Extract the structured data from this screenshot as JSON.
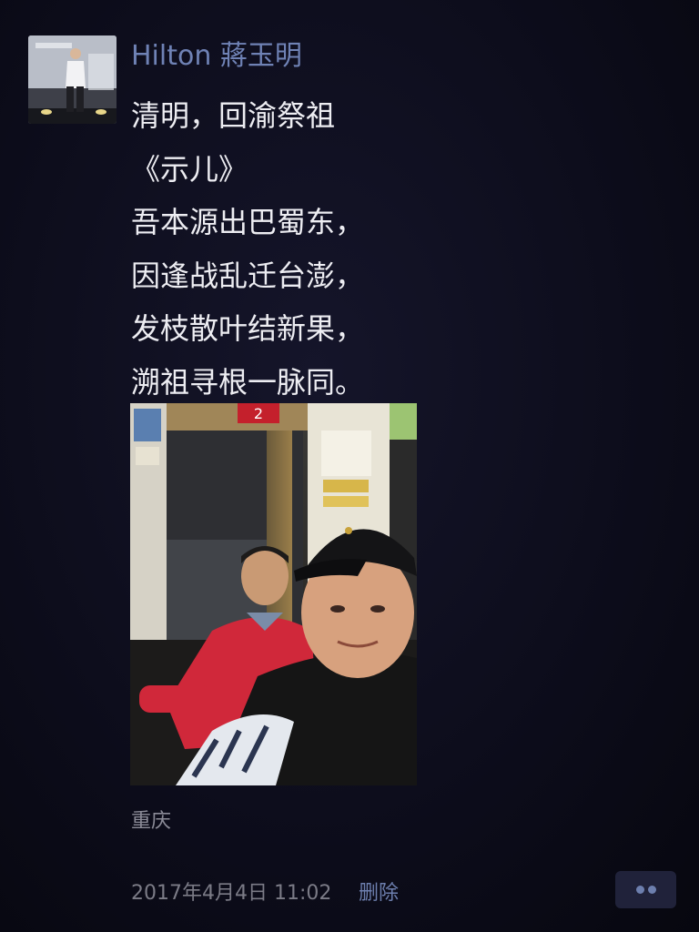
{
  "post": {
    "author": "Hilton 蔣玉明",
    "lines": [
      "清明，回渝祭祖",
      "《示儿》",
      "吾本源出巴蜀东，",
      "因逢战乱迁台澎，",
      "发枝散叶结新果，",
      "溯祖寻根一脉同。"
    ],
    "location": "重庆",
    "timestamp": "2017年4月4日 11:02",
    "delete_label": "删除",
    "photo_sign_text": "2"
  },
  "colors": {
    "background": "#0d0d1c",
    "author_name": "#6f82b5",
    "link": "#6d7fae",
    "body_text": "#ededf2",
    "meta_text": "#7b7b86",
    "photo_jacket_red": "#d0283a",
    "photo_sign_red": "#c4202c"
  },
  "icons": {
    "more": "more-dots-icon"
  }
}
